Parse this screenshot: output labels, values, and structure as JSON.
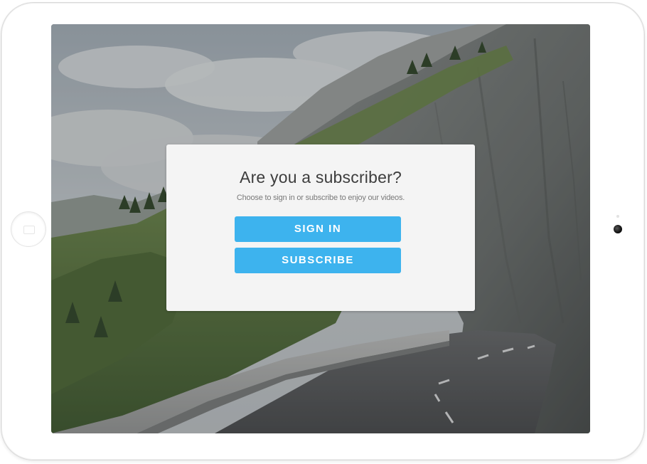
{
  "dialog": {
    "title": "Are you a subscriber?",
    "subtitle": "Choose to sign in or subscribe to enjoy our videos.",
    "sign_in_label": "SIGN IN",
    "subscribe_label": "SUBSCRIBE"
  },
  "colors": {
    "button": "#3db3ee",
    "dialog_background": "#f4f4f4",
    "tablet_frame": "#ffffff"
  },
  "icons": {
    "home_button": "home-button-icon",
    "camera": "camera-icon"
  }
}
